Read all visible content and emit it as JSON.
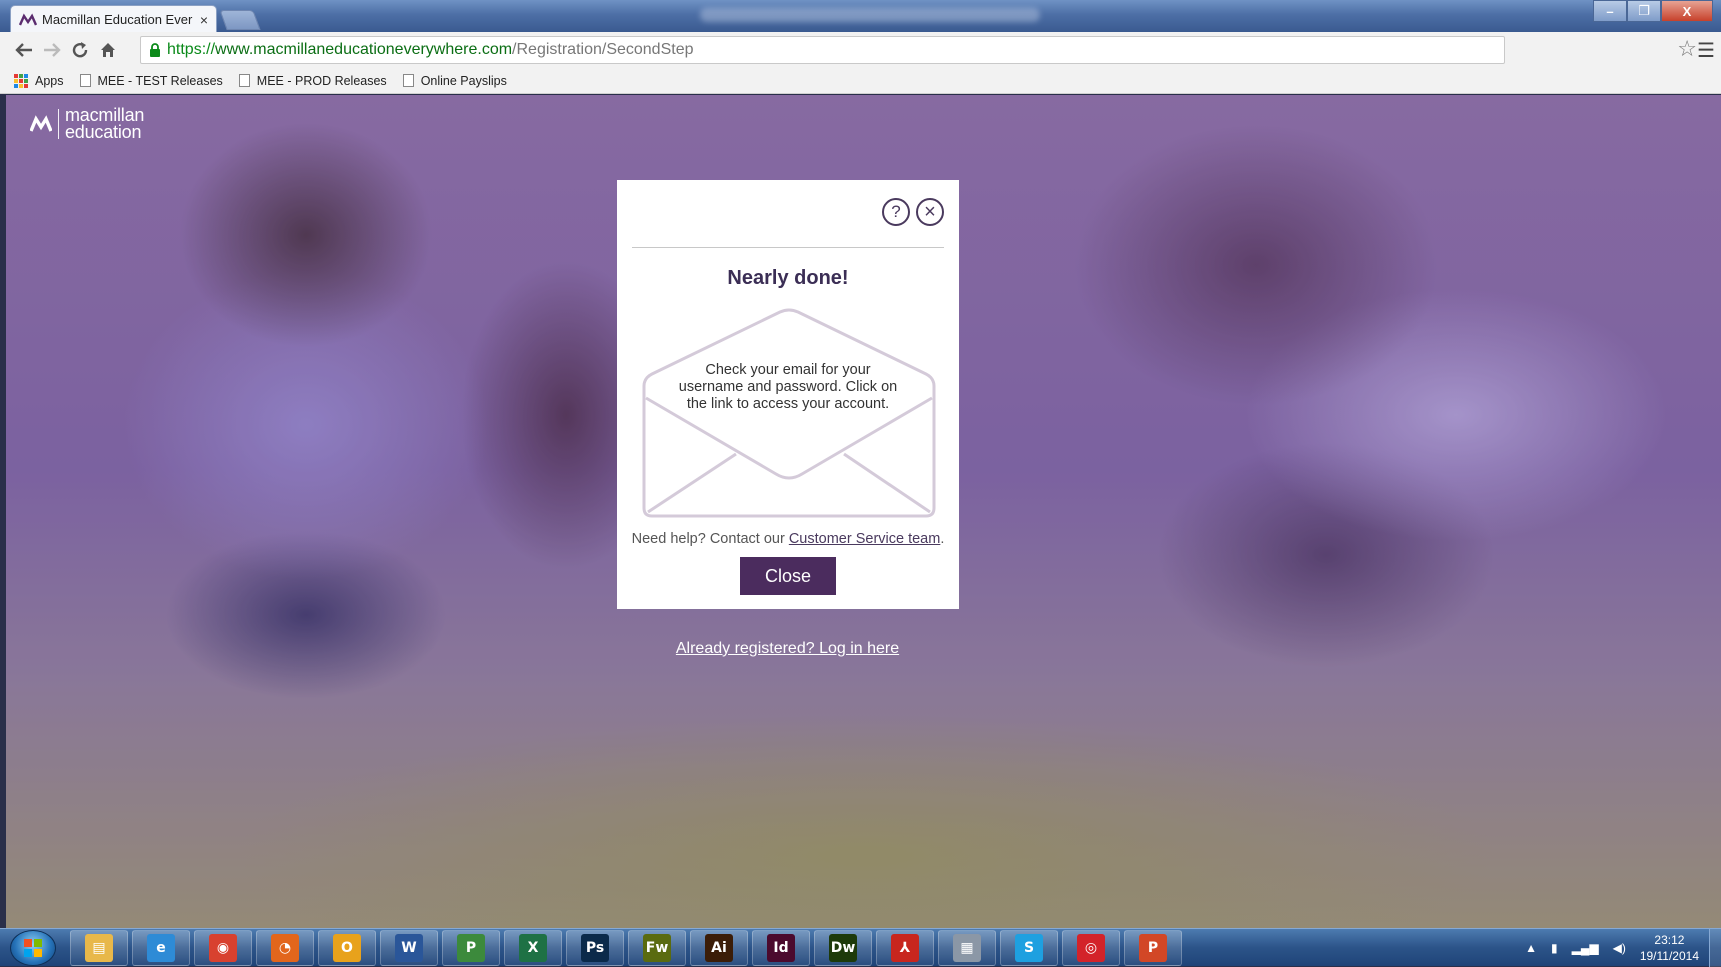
{
  "browser": {
    "tab_title": "Macmillan Education Ever",
    "tab_close": "×",
    "url_scheme": "https://",
    "url_host": "www.macmillaneducationeverywhere.com",
    "url_path": "/Registration/SecondStep",
    "window_controls": {
      "minimize": "–",
      "restore": "❐",
      "close": "X"
    }
  },
  "bookmarks": [
    {
      "label": "Apps"
    },
    {
      "label": "MEE - TEST Releases"
    },
    {
      "label": "MEE - PROD Releases"
    },
    {
      "label": "Online Payslips"
    }
  ],
  "brand": {
    "line1": "macmillan",
    "line2": "education"
  },
  "modal": {
    "help_glyph": "?",
    "close_glyph": "×",
    "title": "Nearly done!",
    "message": "Check your email for your username and password. Click on the link to access your account.",
    "help_prefix": "Need help? Contact our ",
    "help_link": "Customer Service team",
    "help_suffix": ".",
    "close_button": "Close"
  },
  "login_link": "Already registered? Log in here",
  "taskbar": {
    "apps": [
      {
        "name": "explorer",
        "glyph": "▤",
        "color": "#e8b84a"
      },
      {
        "name": "internet-explorer",
        "glyph": "e",
        "color": "#2e8bd6"
      },
      {
        "name": "chrome",
        "glyph": "◉",
        "color": "#d8412f"
      },
      {
        "name": "firefox",
        "glyph": "◔",
        "color": "#e2661c"
      },
      {
        "name": "outlook",
        "glyph": "O",
        "color": "#e8a21c"
      },
      {
        "name": "word",
        "glyph": "W",
        "color": "#2a5699"
      },
      {
        "name": "project",
        "glyph": "P",
        "color": "#3c8a3c"
      },
      {
        "name": "excel",
        "glyph": "X",
        "color": "#1e7145"
      },
      {
        "name": "photoshop",
        "glyph": "Ps",
        "color": "#0b2a4a"
      },
      {
        "name": "fireworks",
        "glyph": "Fw",
        "color": "#5a6b10"
      },
      {
        "name": "illustrator",
        "glyph": "Ai",
        "color": "#3b1d08"
      },
      {
        "name": "indesign",
        "glyph": "Id",
        "color": "#4b0a2e"
      },
      {
        "name": "dreamweaver",
        "glyph": "Dw",
        "color": "#1d3a0a"
      },
      {
        "name": "acrobat",
        "glyph": "⅄",
        "color": "#c8261e"
      },
      {
        "name": "calculator",
        "glyph": "▦",
        "color": "#8b97a6"
      },
      {
        "name": "skype",
        "glyph": "S",
        "color": "#1ea0e0"
      },
      {
        "name": "creative-cloud",
        "glyph": "◎",
        "color": "#d3232a"
      },
      {
        "name": "powerpoint",
        "glyph": "P",
        "color": "#d24726"
      }
    ],
    "tray_up": "▲",
    "tray_power": "▮",
    "tray_signal": "▂▄▆",
    "tray_volume": "◀)",
    "time": "23:12",
    "date": "19/11/2014"
  }
}
